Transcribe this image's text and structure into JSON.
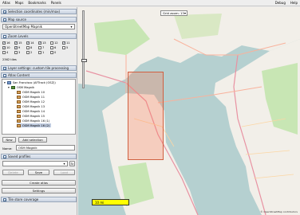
{
  "menubar": {
    "left": [
      "Atlas",
      "Maps",
      "Bookmarks",
      "Panels"
    ],
    "right": [
      "Debug",
      "Help"
    ]
  },
  "sections": {
    "selection": "Selection coordinates (min/max)",
    "map_source": "Map source",
    "zoom_levels": "Zoom Levels",
    "layer_settings": "Layer settings: custom tile processing",
    "atlas_content": "Atlas Content",
    "saved_profiles": "Saved profiles",
    "tile_store": "Tile store coverage"
  },
  "map_source": {
    "value": "OpenStreetMap Mapnik"
  },
  "zoom_levels": {
    "labels": [
      "16",
      "15",
      "14",
      "13",
      "12",
      "11",
      "10",
      "9",
      "8",
      "7",
      "6",
      "5",
      "4",
      "3",
      "2",
      "1",
      "0"
    ],
    "checked": [
      true,
      true,
      true,
      true,
      false,
      true,
      true,
      true,
      false,
      false,
      false,
      false,
      false,
      false,
      false,
      false,
      false
    ],
    "tiles_text": "2362 tiles"
  },
  "atlas_tree": {
    "root": "San Francisco (AFTrack (OSZ))",
    "layer": "OSM Magnik",
    "maps": [
      "OSM Magnik 10",
      "OSM Magnik 11",
      "OSM Magnik 12",
      "OSM Magnik 13",
      "OSM Magnik 14",
      "OSM Magnik 15",
      "OSM Magnik 16 (1)",
      "OSM Magnik 16 (2)"
    ]
  },
  "buttons": {
    "new": "New",
    "add_selection": "Add selection",
    "delete": "Delete",
    "save": "Save",
    "load": "Load",
    "create_atlas": "Create atlas",
    "settings": "Settings"
  },
  "name_field": {
    "label": "Name:",
    "value": "OSM Magnik"
  },
  "map": {
    "grid_zoom": "Grid zoom: 13",
    "scale": "10 mi",
    "copyright": "© OpenStreetMap contributors"
  },
  "colors": {
    "water": "#b5d0d0",
    "land": "#f2efe9",
    "park": "#c8e6b4",
    "selection": "#ff7850"
  }
}
